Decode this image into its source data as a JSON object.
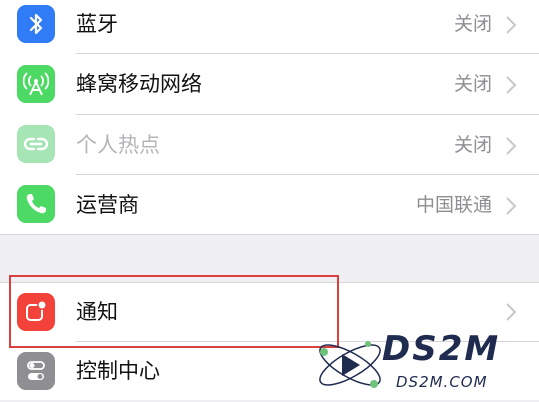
{
  "settings": {
    "group1": [
      {
        "label": "蓝牙",
        "value": "关闭",
        "icon": "bluetooth-icon",
        "color": "#2f7cf6"
      },
      {
        "label": "蜂窝移动网络",
        "value": "关闭",
        "icon": "cellular-antenna-icon",
        "color": "#4cd964"
      },
      {
        "label": "个人热点",
        "value": "关闭",
        "icon": "hotspot-link-icon",
        "color": "#a6e5b4",
        "disabled": true
      },
      {
        "label": "运营商",
        "value": "中国联通",
        "icon": "phone-icon",
        "color": "#4cd964"
      }
    ],
    "group2": [
      {
        "label": "通知",
        "value": "",
        "icon": "notifications-icon",
        "color": "#f2423a"
      },
      {
        "label": "控制中心",
        "value": "",
        "icon": "control-center-icon",
        "color": "#8e8e93"
      }
    ]
  },
  "watermark": {
    "title": "DS2M",
    "url": "DS2M.COM"
  },
  "colors": {
    "highlight_box": "#d9413f",
    "background": "#efeff4"
  }
}
